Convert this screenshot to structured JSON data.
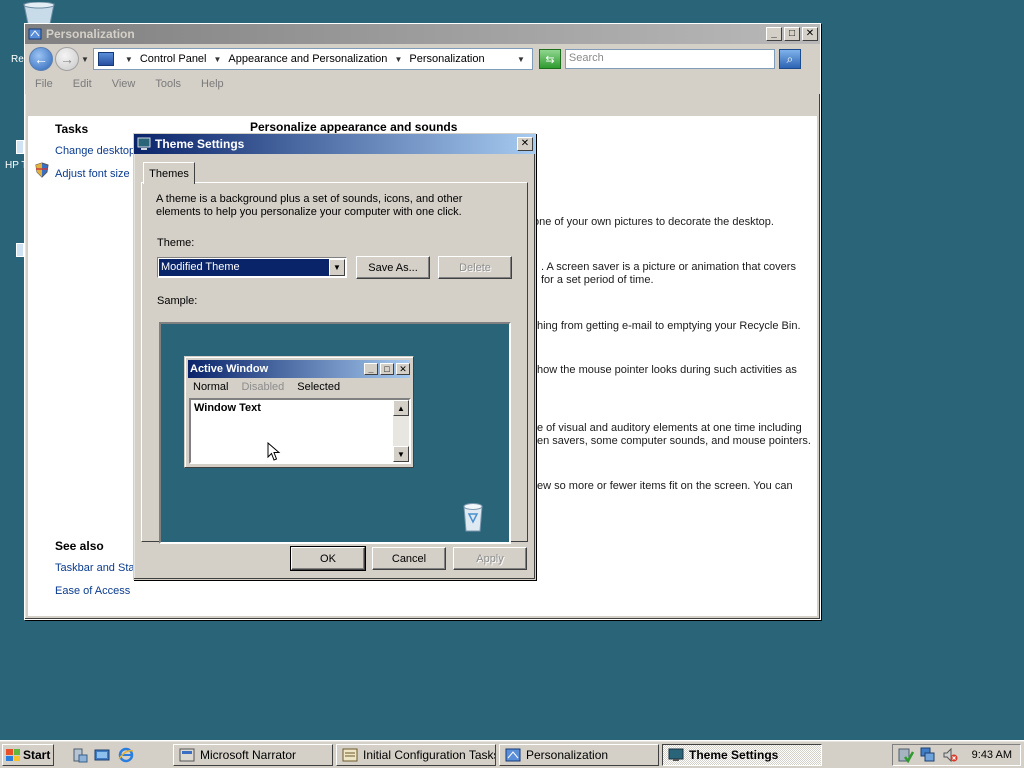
{
  "desktop": {
    "frag_re": "Re",
    "frag_hp": "HP T"
  },
  "personalization_window": {
    "title": "Personalization",
    "breadcrumb": [
      "Control Panel",
      "Appearance and Personalization",
      "Personalization"
    ],
    "search_placeholder": "Search",
    "menu": [
      "File",
      "Edit",
      "View",
      "Tools",
      "Help"
    ],
    "tasks_title": "Tasks",
    "tasks": [
      "Change desktop",
      "Adjust font size"
    ],
    "see_also_title": "See also",
    "see_also": [
      "Taskbar and Sta",
      "Ease of Access"
    ],
    "heading": "Personalize appearance and sounds",
    "descriptions": [
      "one of your own pictures to decorate the desktop.",
      ". A screen saver is a picture or animation that covers",
      "for a set period of time.",
      "hing from getting e-mail to emptying your Recycle Bin.",
      "how the mouse pointer looks during such activities as",
      "e of visual and auditory elements at one time including",
      "en savers, some computer sounds, and mouse pointers.",
      "ew so more or fewer items fit on the screen. You can"
    ]
  },
  "theme_dialog": {
    "title": "Theme Settings",
    "tab": "Themes",
    "intro": "A theme is a background plus a set of sounds, icons, and other elements to help you personalize your computer with one click.",
    "theme_label": "Theme:",
    "theme_value": "Modified Theme",
    "save_as": "Save As...",
    "delete": "Delete",
    "sample_label": "Sample:",
    "sample": {
      "window_title": "Active Window",
      "menu_normal": "Normal",
      "menu_disabled": "Disabled",
      "menu_selected": "Selected",
      "window_text": "Window Text"
    },
    "ok": "OK",
    "cancel": "Cancel",
    "apply": "Apply"
  },
  "taskbar": {
    "start": "Start",
    "buttons": [
      "Microsoft Narrator",
      "Initial Configuration Tasks",
      "Personalization",
      "Theme Settings"
    ],
    "active_index": 3,
    "clock": "9:43 AM"
  },
  "colors": {
    "desktop": "#2a6478",
    "active_title_start": "#0a246a",
    "active_title_end": "#a6caf0",
    "link": "#0a3b8f"
  }
}
